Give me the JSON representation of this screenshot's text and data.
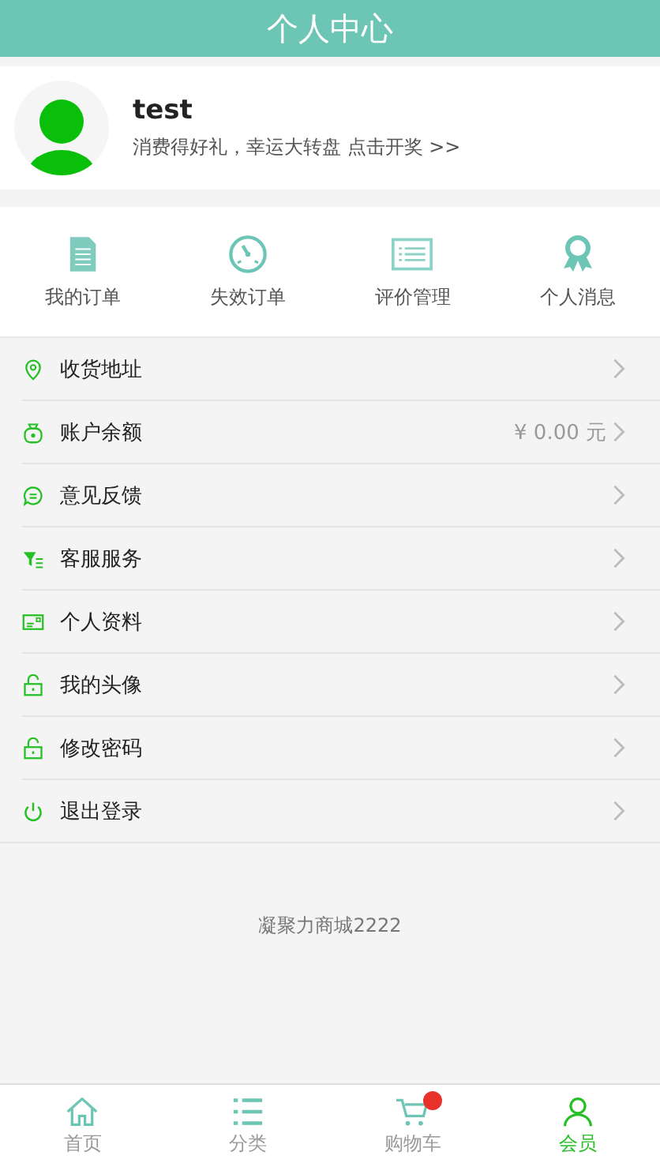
{
  "header": {
    "title": "个人中心"
  },
  "profile": {
    "name": "test",
    "promo": "消费得好礼，幸运大转盘 点击开奖 >>"
  },
  "shortcuts": [
    {
      "kind": "document",
      "label": "我的订单"
    },
    {
      "kind": "gauge",
      "label": "失效订单"
    },
    {
      "kind": "list",
      "label": "评价管理"
    },
    {
      "kind": "award",
      "label": "个人消息"
    }
  ],
  "menu": [
    {
      "kind": "pin",
      "label": "收货地址"
    },
    {
      "kind": "bag",
      "label": "账户余额",
      "value": "¥ 0.00 元"
    },
    {
      "kind": "chat",
      "label": "意见反馈"
    },
    {
      "kind": "filter",
      "label": "客服服务"
    },
    {
      "kind": "card",
      "label": "个人资料"
    },
    {
      "kind": "lock",
      "label": "我的头像"
    },
    {
      "kind": "lock",
      "label": "修改密码"
    },
    {
      "kind": "power",
      "label": "退出登录"
    }
  ],
  "footer": "凝聚力商城2222",
  "tabbar": [
    {
      "kind": "home",
      "label": "首页",
      "selected": false
    },
    {
      "kind": "list",
      "label": "分类",
      "selected": false
    },
    {
      "kind": "cart",
      "label": "购物车",
      "selected": false,
      "badge": true
    },
    {
      "kind": "user",
      "label": "会员",
      "selected": true
    }
  ]
}
